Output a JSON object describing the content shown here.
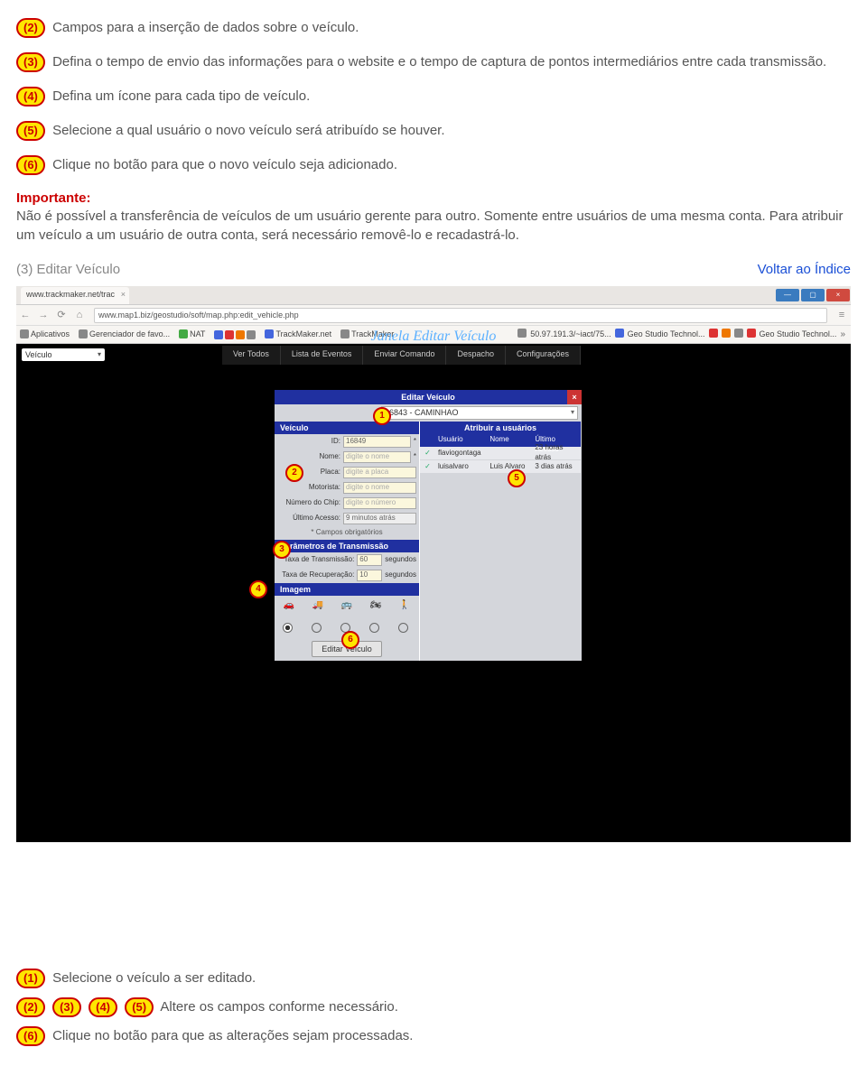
{
  "instructions": {
    "i2": "Campos para a inserção de dados sobre o veículo.",
    "i3": "Defina o tempo de envio das informações para o website e o tempo de captura de pontos intermediários entre cada transmissão.",
    "i4": "Defina um ícone para cada tipo de veículo.",
    "i5": "Selecione a qual usuário o novo veículo será atribuído se houver.",
    "i6": "Clique no botão para que o novo veículo seja adicionado."
  },
  "important": {
    "label": "Importante:",
    "text": "Não é possível a transferência de veículos de um usuário gerente para outro. Somente entre usuários de uma mesma conta. Para atribuir um veículo a um usuário de outra conta, será necessário removê-lo e recadastrá-lo."
  },
  "section": {
    "title": "(3) Editar Veículo",
    "back": "Voltar ao Índice"
  },
  "annotation_title": "Janela Editar Veículo",
  "browser": {
    "tab": "www.trackmaker.net/trac",
    "url": "www.map1.biz/geostudio/soft/map.php:edit_vehicle.php",
    "ip": "50.97.191.3/~iact/75...",
    "bookmarks": {
      "apps": "Aplicativos",
      "fav": "Gerenciador de favo...",
      "nat": "NAT",
      "tm": "TrackMaker.net",
      "tm2": "TrackMaker",
      "geo1": "Geo Studio Technol...",
      "geo2": "Geo Studio Technol..."
    }
  },
  "app": {
    "dropdown": "Veículo",
    "tabs": [
      "Ver Todos",
      "Lista de Eventos",
      "Enviar Comando",
      "Despacho",
      "Configurações"
    ]
  },
  "panel": {
    "title": "Editar Veículo",
    "select": "16843 - CAMINHAO",
    "left": {
      "hd_vehicle": "Veículo",
      "id_label": "ID:",
      "id_value": "16849",
      "name_label": "Nome:",
      "name_ph": "digite o nome",
      "plate_label": "Placa:",
      "plate_ph": "digite a placa",
      "driver_label": "Motorista:",
      "driver_ph": "digite o nome",
      "chip_label": "Número do Chip:",
      "chip_ph": "digite o número",
      "last_label": "Último Acesso:",
      "last_value": "9 minutos atrás",
      "note": "* Campos obrigatórios",
      "hd_params": "Parâmetros de Transmissão",
      "tx_label": "Taxa de Transmissão:",
      "tx_value": "60",
      "rec_label": "Taxa de Recuperação:",
      "rec_value": "10",
      "seconds": "segundos",
      "hd_image": "Imagem",
      "button": "Editar Veículo"
    },
    "right": {
      "hd": "Atribuir a usuários",
      "cols": {
        "user": "Usuário",
        "name": "Nome",
        "last": "Último Acesso"
      },
      "rows": [
        {
          "chk": "✓",
          "user": "flaviogontaga",
          "name": "",
          "last": "23 horas atrás"
        },
        {
          "chk": "✓",
          "user": "luisalvaro",
          "name": "Luis Alvaro",
          "last": "3 dias atrás"
        }
      ]
    }
  },
  "bottom": {
    "b1": "Selecione o veículo a ser editado.",
    "b2": "Altere os campos conforme necessário.",
    "b6": "Clique no botão para que as alterações sejam processadas."
  }
}
